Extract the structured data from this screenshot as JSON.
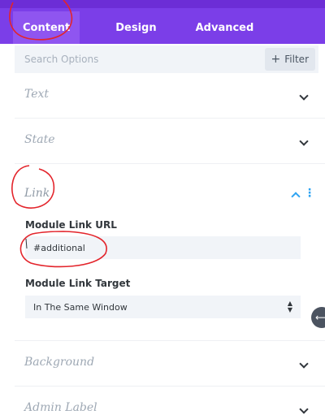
{
  "tabs": [
    {
      "label": "Content"
    },
    {
      "label": "Design"
    },
    {
      "label": "Advanced"
    }
  ],
  "search": {
    "placeholder": "Search Options"
  },
  "filter": {
    "label": "Filter"
  },
  "sections": {
    "text": {
      "title": "Text"
    },
    "state": {
      "title": "State"
    },
    "link": {
      "title": "Link"
    },
    "background": {
      "title": "Background"
    },
    "admin_label": {
      "title": "Admin Label"
    }
  },
  "link": {
    "url_label": "Module Link URL",
    "url_value": "#additional",
    "target_label": "Module Link Target",
    "target_value": "In The Same Window"
  },
  "icons": [
    "chevron-down-icon",
    "chevron-up-icon",
    "more-vertical-icon",
    "plus-icon",
    "select-arrows-icon",
    "collapse-arrow-icon"
  ],
  "colors": {
    "header": "#7b3ee8",
    "accent": "#2ea3f2",
    "annotation": "#e3242b"
  }
}
